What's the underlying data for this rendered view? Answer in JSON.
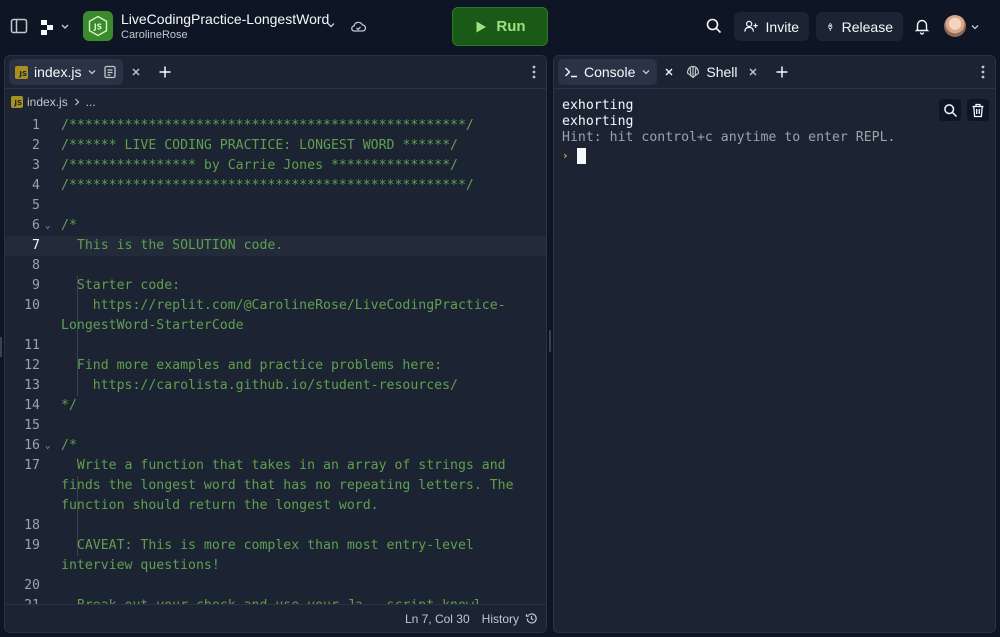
{
  "repl": {
    "title": "LiveCodingPractice-LongestWord",
    "owner": "CarolineRose",
    "logo_text": "JS"
  },
  "toolbar": {
    "run_label": "Run",
    "invite_label": "Invite",
    "release_label": "Release"
  },
  "editor": {
    "tab_label": "index.js",
    "breadcrumb_file": "index.js",
    "breadcrumb_more": "...",
    "lines": [
      {
        "n": "1",
        "text": "/**************************************************/"
      },
      {
        "n": "2",
        "text": "/****** LIVE CODING PRACTICE: LONGEST WORD ******/"
      },
      {
        "n": "3",
        "text": "/**************** by Carrie Jones ***************/"
      },
      {
        "n": "4",
        "text": "/**************************************************/"
      },
      {
        "n": "5",
        "text": ""
      },
      {
        "n": "6",
        "text": "/*"
      },
      {
        "n": "7",
        "text": "  This is the SOLUTION code."
      },
      {
        "n": "8",
        "text": ""
      },
      {
        "n": "9",
        "text": "  Starter code:"
      },
      {
        "n": "10",
        "text": "    https://replit.com/@CarolineRose/LiveCodingPractice-"
      },
      {
        "n": "",
        "text": "LongestWord-StarterCode"
      },
      {
        "n": "11",
        "text": ""
      },
      {
        "n": "12",
        "text": "  Find more examples and practice problems here:"
      },
      {
        "n": "13",
        "text": "    https://carolista.github.io/student-resources/"
      },
      {
        "n": "14",
        "text": "*/"
      },
      {
        "n": "15",
        "text": ""
      },
      {
        "n": "16",
        "text": "/*"
      },
      {
        "n": "17",
        "text": "  Write a function that takes in an array of strings and"
      },
      {
        "n": "",
        "text": "finds the longest word that has no repeating letters. The"
      },
      {
        "n": "",
        "text": "function should return the longest word."
      },
      {
        "n": "18",
        "text": ""
      },
      {
        "n": "19",
        "text": "  CAVEAT: This is more complex than most entry-level"
      },
      {
        "n": "",
        "text": "interview questions!"
      },
      {
        "n": "20",
        "text": ""
      },
      {
        "n": "21",
        "text": "  Break out your check and use your Ja...script knowl..."
      }
    ],
    "cursor_position": "Ln 7, Col 30",
    "history_label": "History"
  },
  "console": {
    "tab_label": "Console",
    "shell_label": "Shell",
    "output": [
      "exhorting",
      "exhorting"
    ],
    "hint": "Hint: hit control+c anytime to enter REPL."
  },
  "colors": {
    "background": "#0e1525",
    "pane": "#1c2333",
    "comment_green": "#5fa04e",
    "run_green": "#1a5a19"
  }
}
